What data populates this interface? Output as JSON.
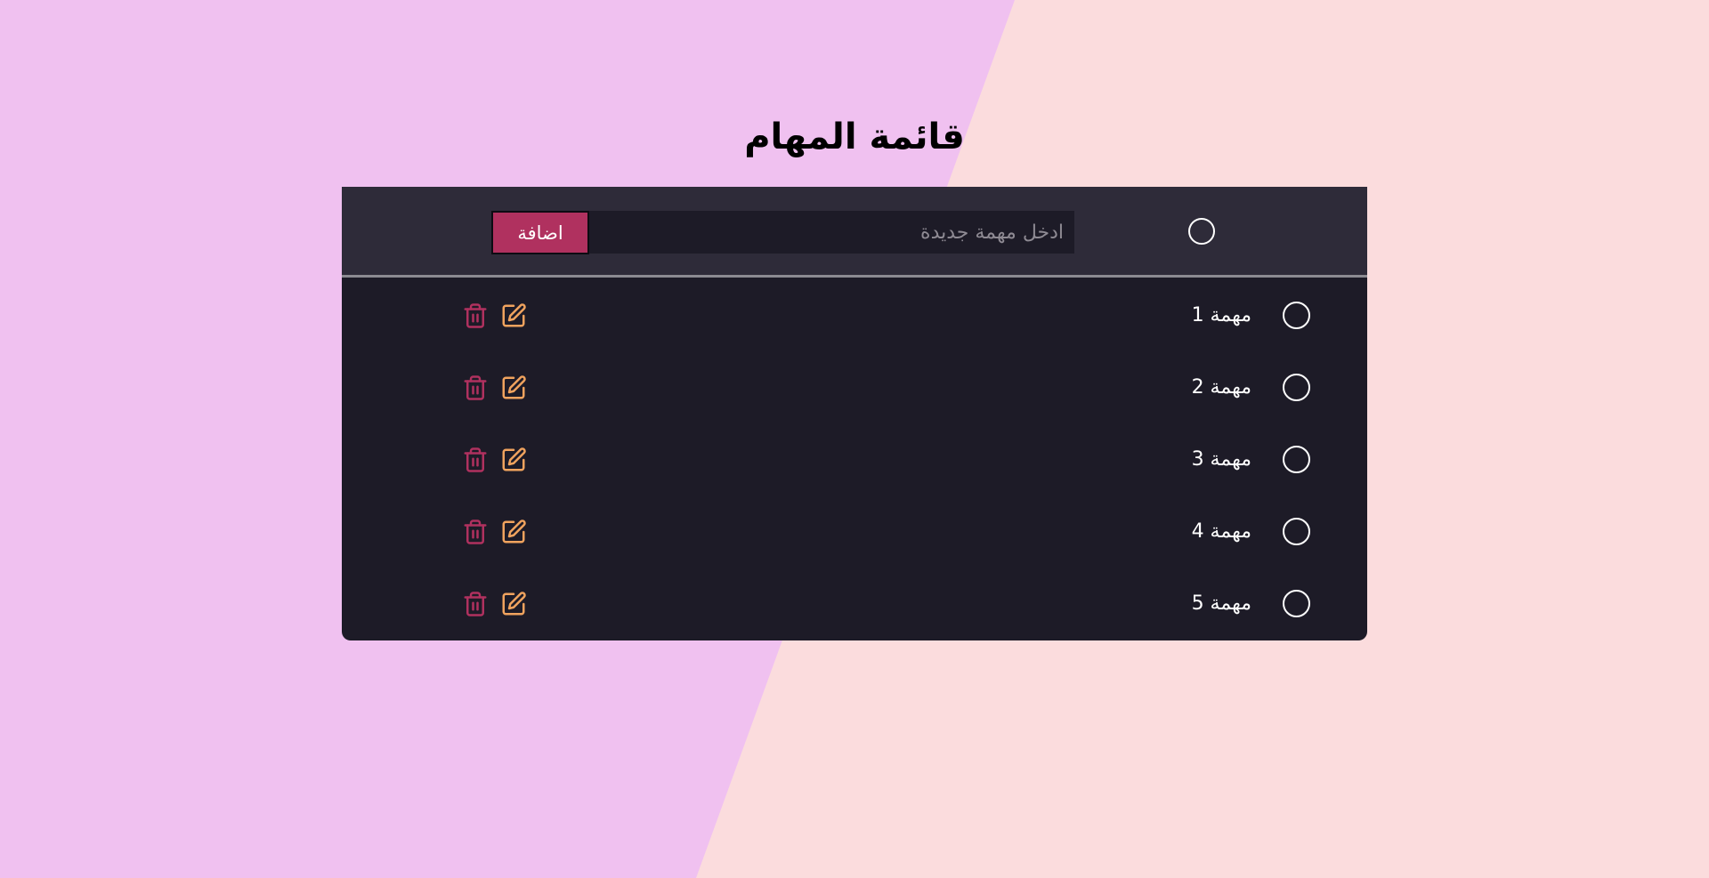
{
  "page": {
    "title": "قائمة المهام"
  },
  "add_form": {
    "input_placeholder": "ادخل مهمة جديدة",
    "input_value": "",
    "button_label": "اضافة"
  },
  "tasks": [
    {
      "label": "مهمة 1"
    },
    {
      "label": "مهمة 2"
    },
    {
      "label": "مهمة 3"
    },
    {
      "label": "مهمة 4"
    },
    {
      "label": "مهمة 5"
    }
  ],
  "icons": {
    "task_toggle": "circle-icon",
    "edit": "edit-icon",
    "delete": "trash-icon"
  },
  "colors": {
    "background_left": "#f0c1f0",
    "background_right": "#fbdcdd",
    "panel": "#1d1b27",
    "add_bar": "#2e2b39",
    "add_button": "#b0315f",
    "edit_icon": "#f0a35e",
    "delete_icon": "#b0315f",
    "text": "#ffffff"
  }
}
